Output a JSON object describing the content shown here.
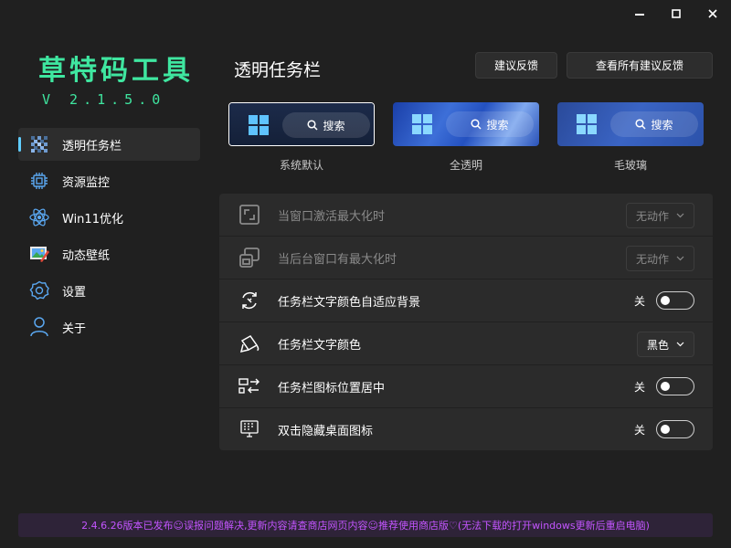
{
  "window_controls": [
    "minimize-icon",
    "maximize-icon",
    "close-icon"
  ],
  "logo": {
    "title": "草特码工具",
    "version": "V 2.1.5.0",
    "color": "#3fe6a0"
  },
  "sidebar": {
    "accent": "#60cdff",
    "items": [
      {
        "label": "透明任务栏",
        "icon": "taskbar-transparent-icon",
        "active": true
      },
      {
        "label": "资源监控",
        "icon": "chip-icon"
      },
      {
        "label": "Win11优化",
        "icon": "atom-icon"
      },
      {
        "label": "动态壁纸",
        "icon": "wallpaper-icon"
      },
      {
        "label": "设置",
        "icon": "gear-icon"
      },
      {
        "label": "关于",
        "icon": "person-icon"
      }
    ]
  },
  "header": {
    "title": "透明任务栏",
    "feedback_button": "建议反馈",
    "view_all_button": "查看所有建议反馈"
  },
  "themes": [
    {
      "label": "系统默认",
      "search": "搜索",
      "selected": true
    },
    {
      "label": "全透明",
      "search": "搜索"
    },
    {
      "label": "毛玻璃",
      "search": "搜索"
    }
  ],
  "settings": [
    {
      "label": "当窗口激活最大化时",
      "icon": "maximize-window-icon",
      "control": "dropdown",
      "value": "无动作",
      "disabled": true
    },
    {
      "label": "当后台窗口有最大化时",
      "icon": "background-window-icon",
      "control": "dropdown",
      "value": "无动作",
      "disabled": true
    },
    {
      "label": "任务栏文字颜色自适应背景",
      "icon": "adaptive-color-icon",
      "control": "toggle",
      "value": "关"
    },
    {
      "label": "任务栏文字颜色",
      "icon": "paint-bucket-icon",
      "control": "dropdown",
      "value": "黑色"
    },
    {
      "label": "任务栏图标位置居中",
      "icon": "align-center-icon",
      "control": "toggle",
      "value": "关"
    },
    {
      "label": "双击隐藏桌面图标",
      "icon": "desktop-icon",
      "control": "toggle",
      "value": "关"
    }
  ],
  "footer": {
    "text": "2.4.6.26版本已发布☺误报问题解决,更新内容请查商店网页内容☺推荐使用商店版♡(无法下载的打开windows更新后重启电脑)",
    "color": "#c355ff"
  }
}
